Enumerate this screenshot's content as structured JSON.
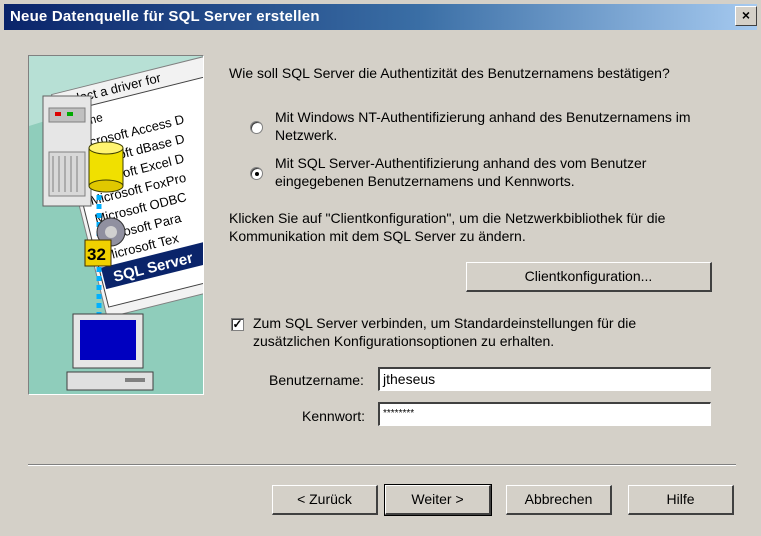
{
  "window": {
    "title": "Neue Datenquelle für SQL Server erstellen",
    "close_glyph": "×"
  },
  "illustration": {
    "header": "Select a driver for",
    "header_col": "Name",
    "drivers": [
      "Microsoft Access D",
      "Microsoft dBase D",
      "Microsoft Excel D",
      "Microsoft FoxPro",
      "Microsoft ODBC",
      "Microsoft Para",
      "Microsoft Tex"
    ],
    "selected": "SQL Server",
    "badge": "32"
  },
  "question": "Wie soll SQL Server die Authentizität des Benutzernamens bestätigen?",
  "options": [
    {
      "label_line1": "Mit Windows NT-Authentifizierung anhand des Benutzernamens im",
      "label_line2": "Netzwerk.",
      "selected": false
    },
    {
      "label_line1": "Mit SQL Server-Authentifizierung anhand des vom Benutzer",
      "label_line2": "eingegebenen Benutzernamens und Kennworts.",
      "selected": true
    }
  ],
  "client_hint_line1": "Klicken Sie auf \"Clientkonfiguration\", um die Netzwerkbibliothek für die",
  "client_hint_line2": "Kommunikation mit dem SQL Server zu ändern.",
  "client_button": "Clientkonfiguration...",
  "connect": {
    "checked": true,
    "check_glyph": "✓",
    "line1": "Zum SQL Server verbinden, um Standardeinstellungen für die",
    "line2": "zusätzlichen Konfigurationsoptionen zu erhalten."
  },
  "fields": {
    "username_label": "Benutzername:",
    "username_value": "jtheseus",
    "password_label": "Kennwort:",
    "password_value": "********"
  },
  "buttons": {
    "back": "< Zurück",
    "next": "Weiter >",
    "cancel": "Abbrechen",
    "help": "Hilfe"
  }
}
